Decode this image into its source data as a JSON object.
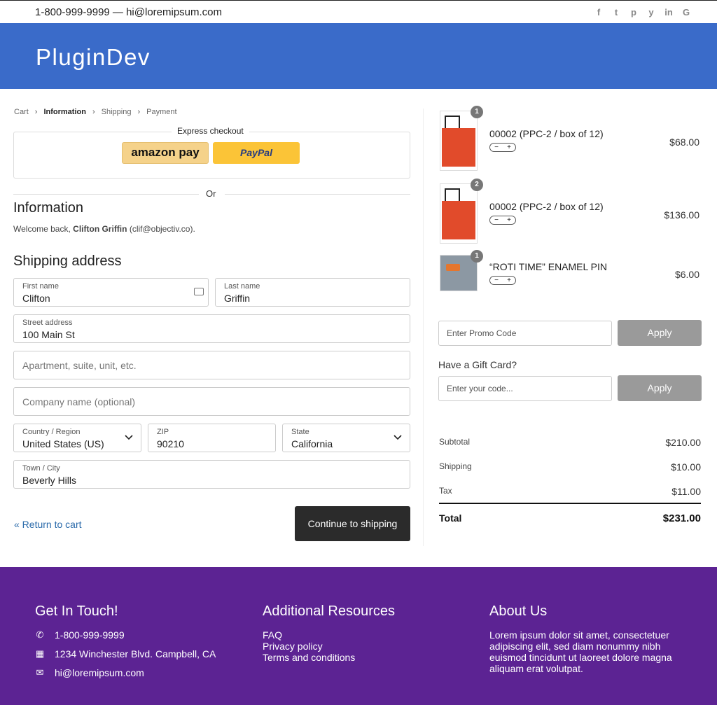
{
  "topbar": {
    "contact": "1-800-999-9999 — hi@loremipsum.com",
    "social": [
      "f",
      "t",
      "p",
      "y",
      "in",
      "G"
    ]
  },
  "header": {
    "logo": "PluginDev"
  },
  "breadcrumb": {
    "cart": "Cart",
    "information": "Information",
    "shipping": "Shipping",
    "payment": "Payment"
  },
  "express": {
    "label": "Express checkout",
    "amazon": "amazon pay",
    "paypal": "PayPal"
  },
  "or_label": "Or",
  "information": {
    "heading": "Information",
    "welcome_prefix": "Welcome back, ",
    "welcome_name": "Clifton Griffin",
    "welcome_email": " (clif@objectiv.co)."
  },
  "shipping": {
    "heading": "Shipping address",
    "first_name": {
      "label": "First name",
      "value": "Clifton"
    },
    "last_name": {
      "label": "Last name",
      "value": "Griffin"
    },
    "street": {
      "label": "Street address",
      "value": "100 Main St"
    },
    "apartment": {
      "placeholder": "Apartment, suite, unit, etc."
    },
    "company": {
      "placeholder": "Company name (optional)"
    },
    "country": {
      "label": "Country / Region",
      "value": "United States (US)"
    },
    "zip": {
      "label": "ZIP",
      "value": "90210"
    },
    "state": {
      "label": "State",
      "value": "California"
    },
    "city": {
      "label": "Town / City",
      "value": "Beverly Hills"
    }
  },
  "actions": {
    "return": "« Return to cart",
    "continue": "Continue to shipping"
  },
  "cart": {
    "items": [
      {
        "qty": "1",
        "name": "00002 (PPC-2 / box of 12)",
        "price": "$68.00",
        "minus": "−",
        "plus": "+"
      },
      {
        "qty": "2",
        "name": "00002 (PPC-2 / box of 12)",
        "price": "$136.00",
        "minus": "−",
        "plus": "+"
      },
      {
        "qty": "1",
        "name": "“ROTI TIME” ENAMEL PIN",
        "price": "$6.00",
        "minus": "−",
        "plus": "+"
      }
    ],
    "promo_placeholder": "Enter Promo Code",
    "apply": "Apply",
    "gift_label": "Have a Gift Card?",
    "gift_placeholder": "Enter your code...",
    "subtotal_label": "Subtotal",
    "subtotal": "$210.00",
    "shipping_label": "Shipping",
    "shipping": "$10.00",
    "tax_label": "Tax",
    "tax": "$11.00",
    "total_label": "Total",
    "total": "$231.00"
  },
  "footer": {
    "contact_heading": "Get In Touch!",
    "phone": "1-800-999-9999",
    "address": "1234 Winchester Blvd. Campbell, CA",
    "email": "hi@loremipsum.com",
    "resources_heading": "Additional Resources",
    "links": [
      "FAQ",
      "Privacy policy",
      "Terms and conditions"
    ],
    "about_heading": "About Us",
    "about_text": "Lorem ipsum dolor sit amet, consectetuer adipiscing elit, sed diam nonummy nibh euismod tincidunt ut laoreet dolore magna aliquam erat volutpat."
  },
  "colors": {
    "header": "#3a6bc9",
    "footer": "#5c2393",
    "button_dark": "#2b2b2b",
    "apply": "#9a9a9a",
    "link": "#2a6aaa"
  }
}
